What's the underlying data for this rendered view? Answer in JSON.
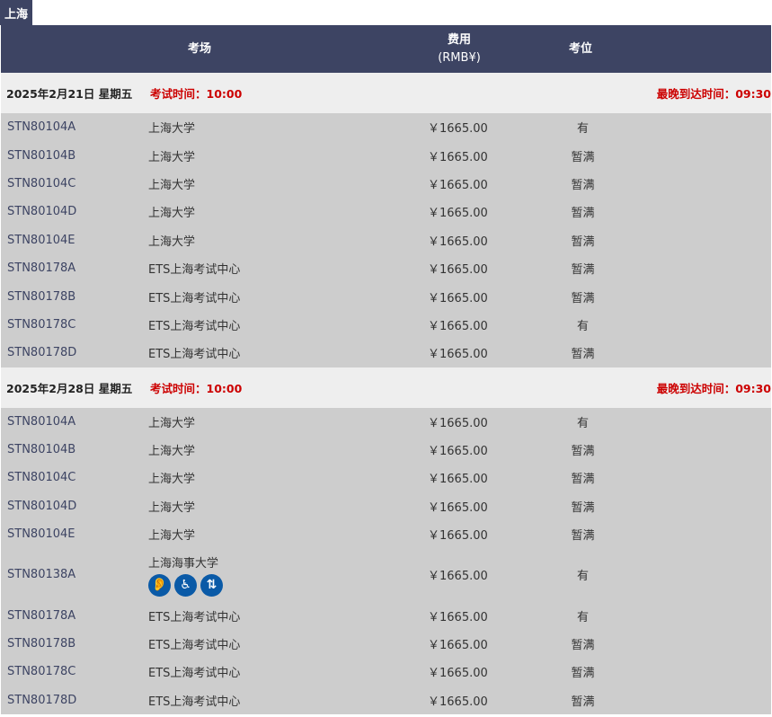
{
  "city_tab": "上海",
  "header": {
    "venue": "考场",
    "fee_label": "费用",
    "fee_unit": "(RMB¥)",
    "seat": "考位"
  },
  "sections": [
    {
      "date": "2025年2月21日 星期五",
      "exam_time": "考试时间：10:00",
      "latest_arrival": "最晚到达时间：09:30",
      "rows": [
        {
          "code": "STN80104A",
          "venue": "上海大学",
          "fee": "￥1665.00",
          "seat": "有"
        },
        {
          "code": "STN80104B",
          "venue": "上海大学",
          "fee": "￥1665.00",
          "seat": "暂满"
        },
        {
          "code": "STN80104C",
          "venue": "上海大学",
          "fee": "￥1665.00",
          "seat": "暂满"
        },
        {
          "code": "STN80104D",
          "venue": "上海大学",
          "fee": "￥1665.00",
          "seat": "暂满"
        },
        {
          "code": "STN80104E",
          "venue": "上海大学",
          "fee": "￥1665.00",
          "seat": "暂满"
        },
        {
          "code": "STN80178A",
          "venue": "ETS上海考试中心",
          "fee": "￥1665.00",
          "seat": "暂满"
        },
        {
          "code": "STN80178B",
          "venue": "ETS上海考试中心",
          "fee": "￥1665.00",
          "seat": "暂满"
        },
        {
          "code": "STN80178C",
          "venue": "ETS上海考试中心",
          "fee": "￥1665.00",
          "seat": "有"
        },
        {
          "code": "STN80178D",
          "venue": "ETS上海考试中心",
          "fee": "￥1665.00",
          "seat": "暂满"
        }
      ]
    },
    {
      "date": "2025年2月28日 星期五",
      "exam_time": "考试时间：10:00",
      "latest_arrival": "最晚到达时间：09:30",
      "rows": [
        {
          "code": "STN80104A",
          "venue": "上海大学",
          "fee": "￥1665.00",
          "seat": "有"
        },
        {
          "code": "STN80104B",
          "venue": "上海大学",
          "fee": "￥1665.00",
          "seat": "暂满"
        },
        {
          "code": "STN80104C",
          "venue": "上海大学",
          "fee": "￥1665.00",
          "seat": "暂满"
        },
        {
          "code": "STN80104D",
          "venue": "上海大学",
          "fee": "￥1665.00",
          "seat": "暂满"
        },
        {
          "code": "STN80104E",
          "venue": "上海大学",
          "fee": "￥1665.00",
          "seat": "暂满"
        },
        {
          "code": "STN80138A",
          "venue": "上海海事大学",
          "fee": "￥1665.00",
          "seat": "有",
          "accessibility_icons": [
            "hearing-icon",
            "wheelchair-icon",
            "elevator-icon"
          ]
        },
        {
          "code": "STN80178A",
          "venue": "ETS上海考试中心",
          "fee": "￥1665.00",
          "seat": "有"
        },
        {
          "code": "STN80178B",
          "venue": "ETS上海考试中心",
          "fee": "￥1665.00",
          "seat": "暂满"
        },
        {
          "code": "STN80178C",
          "venue": "ETS上海考试中心",
          "fee": "￥1665.00",
          "seat": "暂满"
        },
        {
          "code": "STN80178D",
          "venue": "ETS上海考试中心",
          "fee": "￥1665.00",
          "seat": "暂满"
        }
      ]
    }
  ],
  "colors": {
    "header_bg": "#3d4463",
    "row_bg": "#cdcdcd",
    "date_row_bg": "#eeeeee",
    "alert": "#cc0000",
    "icon_bg": "#0a5aa7"
  }
}
